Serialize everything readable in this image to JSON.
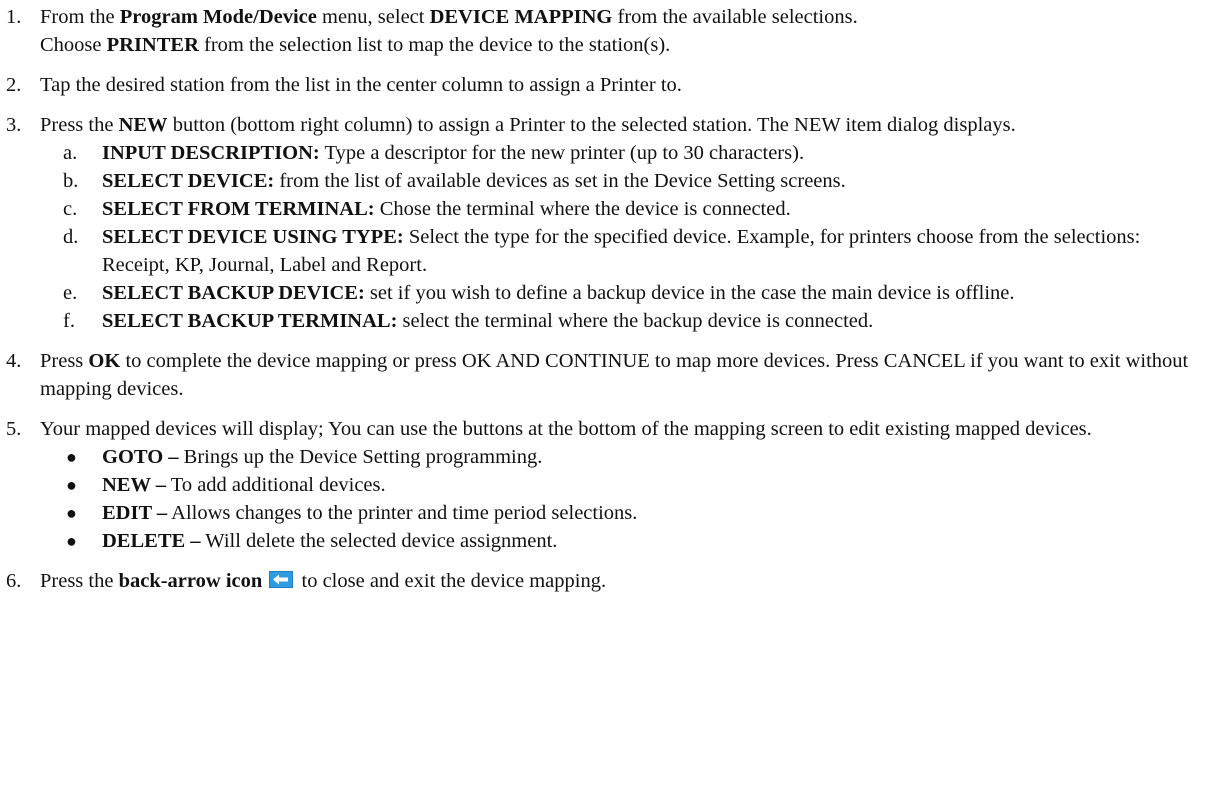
{
  "steps": [
    {
      "num": "1.",
      "line1": {
        "t1": "From the ",
        "b1": "Program Mode/Device",
        "t2": " menu, select ",
        "b2": "DEVICE MAPPING",
        "t3": " from the available selections."
      },
      "line2": {
        "t1": "Choose ",
        "b1": "PRINTER",
        "t2": " from the selection list to map the device to the station(s)."
      }
    },
    {
      "num": "2.",
      "text": "Tap the desired station from the list in the center column to assign a Printer to."
    },
    {
      "num": "3.",
      "t1": "Press the ",
      "b1": "NEW",
      "t2": " button (bottom right column) to assign a Printer to the selected station. The NEW item dialog displays.",
      "subs": [
        {
          "letter": "a.",
          "label": "INPUT DESCRIPTION:",
          "text": " Type a descriptor for the new printer (up to 30 characters)."
        },
        {
          "letter": "b.",
          "label": "SELECT DEVICE:",
          "text": " from the list of available devices as set in the Device Setting screens."
        },
        {
          "letter": "c.",
          "label": "SELECT FROM TERMINAL:",
          "text": " Chose the terminal where the device is connected."
        },
        {
          "letter": "d.",
          "label": "SELECT DEVICE USING TYPE:",
          "text": " Select the type for the specified device. Example, for printers choose from the selections: Receipt, KP, Journal, Label and Report."
        },
        {
          "letter": "e.",
          "label": "SELECT BACKUP DEVICE:",
          "text": " set if you wish to define a backup device in the case the main device is offline."
        },
        {
          "letter": "f.",
          "label": "SELECT BACKUP TERMINAL:",
          "text": " select the terminal where the backup device is connected."
        }
      ]
    },
    {
      "num": "4.",
      "t1": "Press ",
      "b1": "OK",
      "t2": " to complete the device mapping or press OK AND CONTINUE to map more devices. Press CANCEL if you want to exit without mapping devices."
    },
    {
      "num": "5.",
      "text": "Your mapped devices will display; You can use the buttons at the bottom of the mapping screen to edit existing mapped devices.",
      "bullets": [
        {
          "label": "GOTO –",
          "text": " Brings up the Device Setting programming."
        },
        {
          "label": "NEW –",
          "text": " To add additional devices."
        },
        {
          "label": "EDIT –",
          "text": " Allows changes to the printer and time period selections."
        },
        {
          "label": "DELETE –",
          "text": " Will delete the selected device assignment."
        }
      ]
    },
    {
      "num": "6.",
      "t1": "Press the ",
      "b1": "back-arrow icon",
      "t2": " to close and exit the device mapping.",
      "icon": "back-arrow-icon"
    }
  ],
  "colors": {
    "text": "#111111",
    "icon_blue": "#2f9be0"
  }
}
